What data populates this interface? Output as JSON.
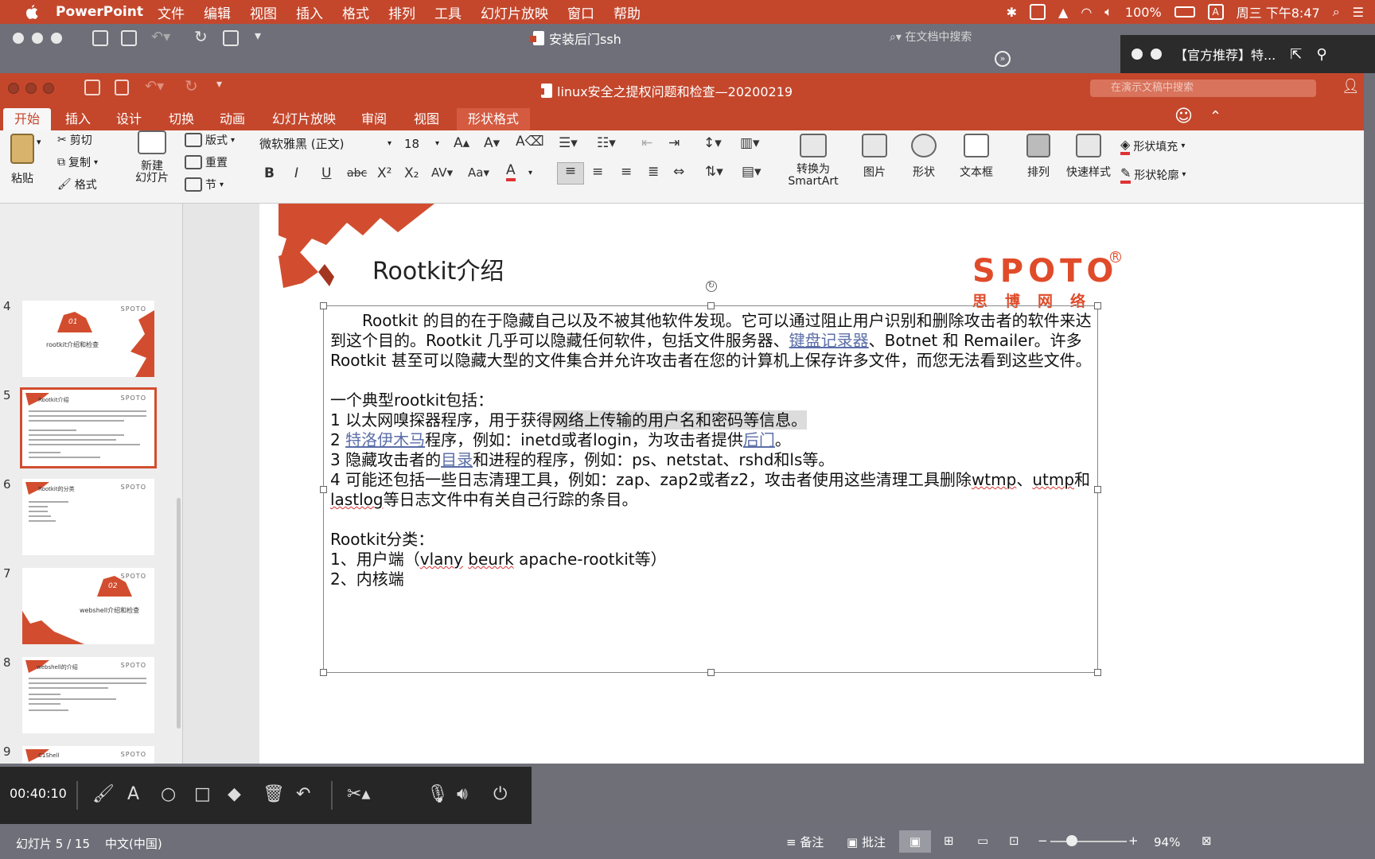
{
  "menubar": {
    "app": "PowerPoint",
    "items": [
      "文件",
      "编辑",
      "视图",
      "插入",
      "格式",
      "排列",
      "工具",
      "幻灯片放映",
      "窗口",
      "帮助"
    ],
    "battery": "100%",
    "input_method": "A",
    "clock": "周三 下午8:47"
  },
  "window1": {
    "title": "安装后门ssh",
    "search_placeholder": "在文档中搜索"
  },
  "recommend_bar": {
    "text": "【官方推荐】特..."
  },
  "window2": {
    "title": "linux安全之提权问题和检查—20200219",
    "search_placeholder": "在演示文稿中搜索"
  },
  "tabs": [
    "开始",
    "插入",
    "设计",
    "切换",
    "动画",
    "幻灯片放映",
    "审阅",
    "视图",
    "形状格式"
  ],
  "ribbon": {
    "paste": "粘贴",
    "cut": "剪切",
    "copy": "复制",
    "format_painter": "格式",
    "new_slide": "新建\n幻灯片",
    "layout": "版式",
    "reset": "重置",
    "section": "节",
    "font_name": "微软雅黑 (正文)",
    "font_size": "18",
    "convert_smartart": "转换为\nSmartArt",
    "picture": "图片",
    "shape": "形状",
    "textbox": "文本框",
    "arrange": "排列",
    "quick_styles": "快速样式",
    "shape_fill": "形状填充",
    "shape_outline": "形状轮廓"
  },
  "thumbnails": [
    {
      "num": "4",
      "caption": "rootkit介绍和检查",
      "badge": "01",
      "logo": "SPOTO"
    },
    {
      "num": "5",
      "caption": "Rootkit介绍",
      "logo": "SPOTO",
      "selected": true
    },
    {
      "num": "6",
      "caption": "Rootkit的分类",
      "logo": "SPOTO"
    },
    {
      "num": "7",
      "caption": "webshell介绍和检查",
      "badge": "02",
      "logo": "SPOTO"
    },
    {
      "num": "8",
      "caption": "webshell的介绍",
      "logo": "SPOTO"
    },
    {
      "num": "9",
      "caption": "C1Shell",
      "logo": "SPOTO"
    }
  ],
  "slide": {
    "title": "Rootkit介绍",
    "logo_en": "SPOTO",
    "logo_mark": "R",
    "logo_cn": "思博网络",
    "para1_a": "Rootkit 的目的在于隐藏自己以及不被其他软件发现。它可以通过阻止用户识别和删除攻击者的软件来达到这个目的。Rootkit 几乎可以隐藏任何软件，包括文件服务器、",
    "para1_link": "键盘记录器",
    "para1_b": "、Botnet 和 Remailer。许多 Rootkit 甚至可以隐藏大型的文件集合并允许攻击者在您的计算机上保存许多文件，而您无法看到这些文件。",
    "typical_heading": "一个典型rootkit包括：",
    "item1_a": "1 以太网嗅探器程序，用于获得",
    "item1_hl": "网络上传输的用户名和密码等信息。",
    "item2_num": "2 ",
    "item2_link": "特洛伊木马",
    "item2_b": "程序，例如：inetd或者login，为攻击者提供",
    "item2_link2": "后门",
    "item2_c": "。",
    "item3_a": "3 隐藏攻击者的",
    "item3_link": "目录",
    "item3_b": "和进程的程序，例如：ps、netstat、rshd和ls等。",
    "item4_a": "4 可能还包括一些日志清理工具，例如：zap、zap2或者z2，攻击者使用这些清理工具删除",
    "item4_w1": "wtmp",
    "item4_b": "、",
    "item4_w2": "utmp",
    "item4_c": "和",
    "item4_w3": "lastlog",
    "item4_d": "等日志文件中有关自己行踪的条目。",
    "class_heading": "Rootkit分类：",
    "class1_a": "1、用户端（",
    "class1_w1": "vlany",
    "class1_sp": " ",
    "class1_w2": "beurk",
    "class1_b": "  apache-rootkit等）",
    "class2": "2、内核端"
  },
  "recorder": {
    "time": "00:40:10"
  },
  "status": {
    "slide_info": "幻灯片 5 / 15",
    "language": "中文(中国)",
    "notes": "备注",
    "comments": "批注",
    "zoom": "94%"
  }
}
